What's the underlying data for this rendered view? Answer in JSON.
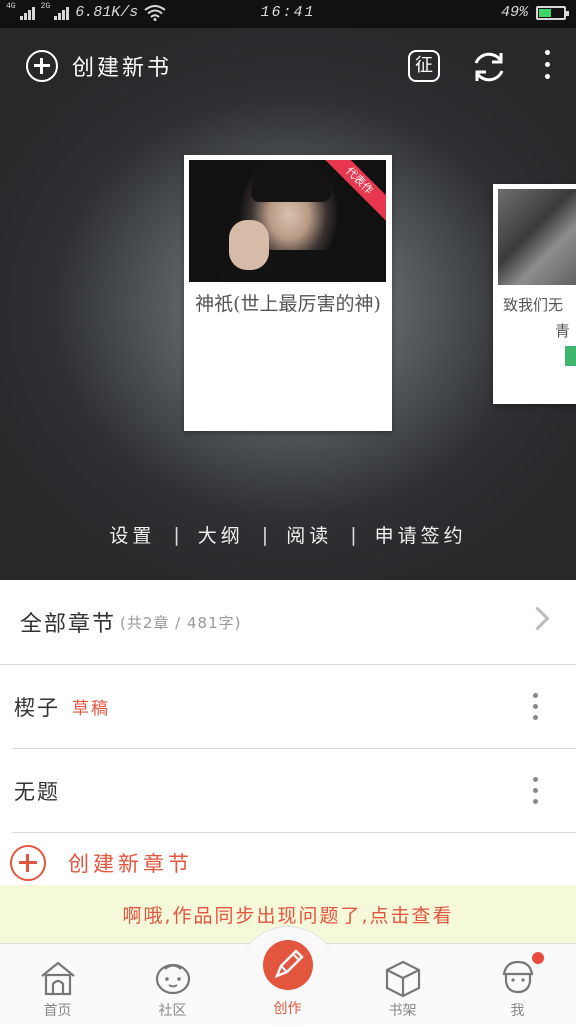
{
  "status_bar": {
    "network_1": "4G",
    "network_2": "2G",
    "speed": "6.81K/s",
    "time": "16:41",
    "battery": "49%",
    "battery_level": 0.49
  },
  "header": {
    "create_book_label": "创建新书",
    "zheng_label": "征"
  },
  "books": [
    {
      "title": "神祇(世上最厉害的神)",
      "ribbon": "代表作"
    },
    {
      "title": "致我们无",
      "title_line2": "青"
    }
  ],
  "actions": {
    "settings": "设置",
    "outline": "大纲",
    "read": "阅读",
    "sign": "申请签约",
    "separator": "|"
  },
  "chapters": {
    "header_label": "全部章节",
    "header_stats": "(共2章 / 481字)",
    "items": [
      {
        "title": "楔子",
        "status": "草稿"
      },
      {
        "title": "无题",
        "status": ""
      }
    ],
    "new_chapter_label": "创建新章节"
  },
  "banner": {
    "text": "啊哦,作品同步出现问题了,点击查看"
  },
  "tabbar": {
    "items": [
      {
        "label": "首页",
        "icon": "home-icon"
      },
      {
        "label": "社区",
        "icon": "community-icon"
      },
      {
        "label": "创作",
        "icon": "pencil-icon",
        "active": true
      },
      {
        "label": "书架",
        "icon": "box-icon"
      },
      {
        "label": "我",
        "icon": "profile-icon",
        "badge": true
      }
    ]
  },
  "colors": {
    "accent": "#e2553e",
    "banner_bg": "#f6f9d9",
    "ribbon": "#e8384f",
    "battery_fill": "#3cd66c"
  }
}
